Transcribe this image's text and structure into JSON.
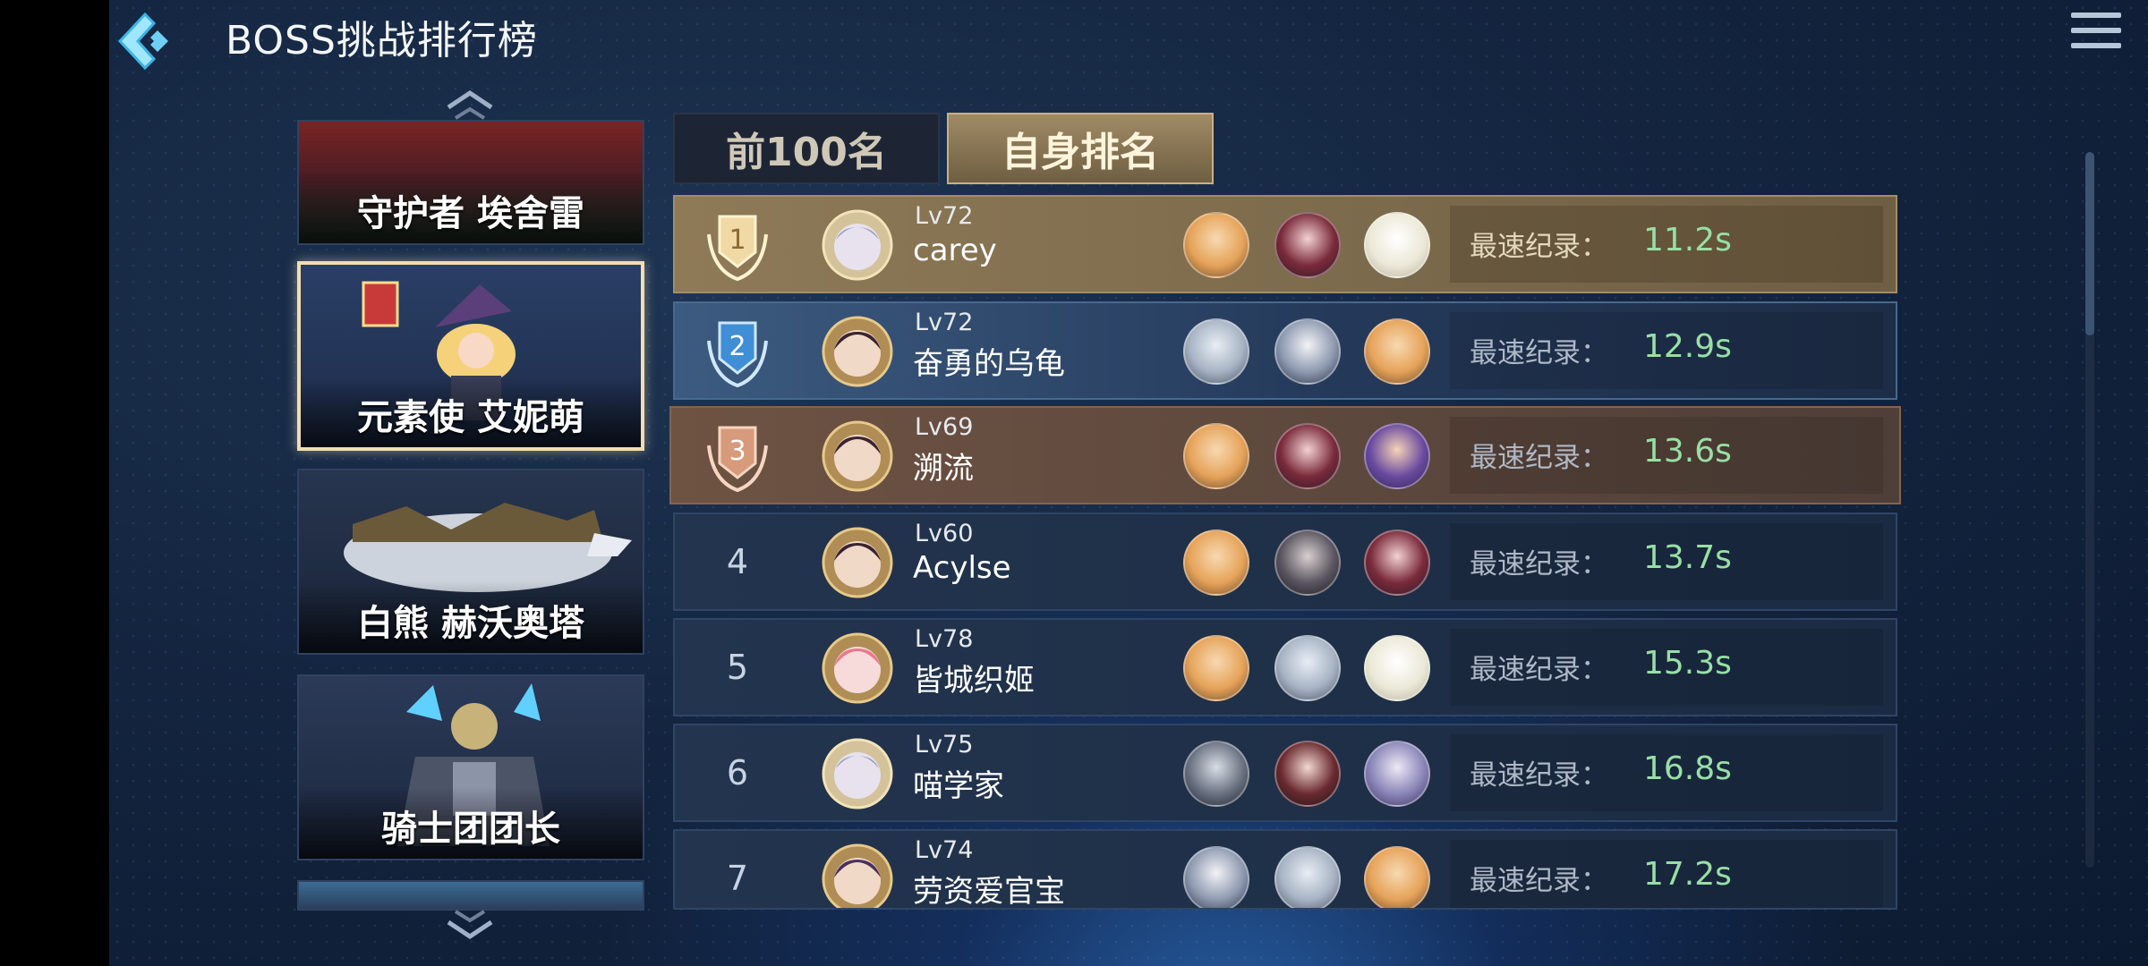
{
  "header": {
    "title": "BOSS挑战排行榜"
  },
  "bosses": [
    {
      "name": "守护者 埃舍雷"
    },
    {
      "name": "元素使 艾妮萌"
    },
    {
      "name": "白熊 赫沃奥塔"
    },
    {
      "name": "骑士团团长"
    }
  ],
  "tabs": {
    "top100": "前100名",
    "self": "自身排名"
  },
  "rows": [
    {
      "rank": "1",
      "level": "Lv72",
      "name": "carey",
      "label": "最速纪录：",
      "time": "11.2s"
    },
    {
      "rank": "2",
      "level": "Lv72",
      "name": "奋勇的乌龟",
      "label": "最速纪录：",
      "time": "12.9s"
    },
    {
      "rank": "3",
      "level": "Lv69",
      "name": "溯流",
      "label": "最速纪录：",
      "time": "13.6s"
    },
    {
      "rank": "4",
      "level": "Lv60",
      "name": "Acylse",
      "label": "最速纪录：",
      "time": "13.7s"
    },
    {
      "rank": "5",
      "level": "Lv78",
      "name": "皆城织姬",
      "label": "最速纪录：",
      "time": "15.3s"
    },
    {
      "rank": "6",
      "level": "Lv75",
      "name": "喵学家",
      "label": "最速纪录：",
      "time": "16.8s"
    },
    {
      "rank": "7",
      "level": "Lv74",
      "name": "劳资爱官宝",
      "label": "最速纪录：",
      "time": "17.2s"
    }
  ],
  "colors": {
    "gold": "#8e7a57",
    "silver": "#3c5b80",
    "bronze": "#6e5343",
    "record_time": "#97e0a4"
  },
  "icons": {
    "back": "back-arrow-icon",
    "menu": "hamburger-menu-icon",
    "scroll_up": "chevron-up-icon",
    "scroll_down": "chevron-down-icon"
  }
}
